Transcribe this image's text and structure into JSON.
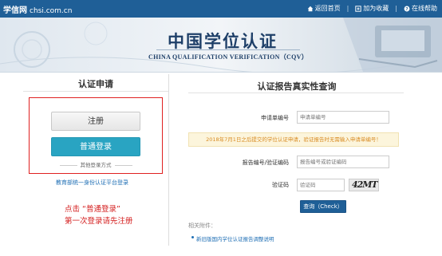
{
  "topbar": {
    "logo_text": "学信网",
    "domain_text": "chsi.com.cn",
    "links": [
      "返回首页",
      "加为收藏",
      "在线帮助"
    ]
  },
  "banner": {
    "title": "中国学位认证",
    "subtitle": "CHINA QUALIFICATION VERIFICATION（CQV）"
  },
  "left": {
    "title": "认证申请",
    "register_label": "注册",
    "login_label": "普通登录",
    "other_login": "其他登录方式",
    "edu_link": "教育部统一身份认证平台登录",
    "note_lines": [
      "点击 “普通登录”",
      "第一次登录请先注册"
    ]
  },
  "right": {
    "title": "认证报告真实性查询",
    "apply_label": "申请单编号",
    "apply_placeholder": "申请单编号",
    "notice": "2018年7月1日之后提交的学位认证申请，验证报告时无需输入申请单编号！",
    "report_label": "报告编号/验证编码",
    "report_placeholder": "报告编号或验证编码",
    "code_label": "验证码",
    "code_placeholder": "验证码",
    "captcha_text": "42MT",
    "query_label": "查询（Check）",
    "attach_title": "相关附件：",
    "attach_link": "新旧版国内学位认证报告调整说明"
  },
  "colors": {
    "topbar": "#1f5f97",
    "login_button": "#29a4c2",
    "highlight_box": "#e02020",
    "note_text": "#d42020",
    "notice_text": "#d88b23"
  }
}
